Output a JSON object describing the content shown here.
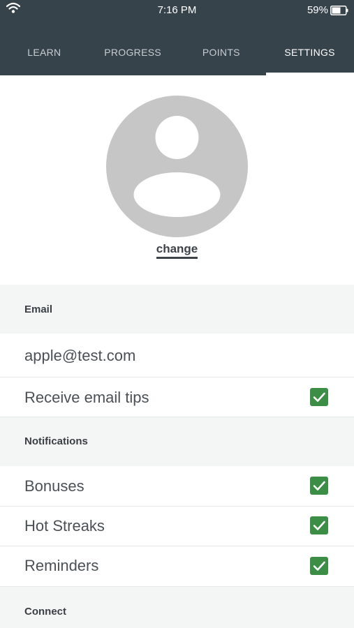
{
  "status_bar": {
    "time": "7:16 PM",
    "battery": "59%"
  },
  "tabs": [
    {
      "label": "LEARN"
    },
    {
      "label": "PROGRESS"
    },
    {
      "label": "POINTS"
    },
    {
      "label": "SETTINGS",
      "active": true
    }
  ],
  "profile": {
    "change_label": "change"
  },
  "sections": {
    "email": {
      "header": "Email",
      "address": "apple@test.com",
      "tips_label": "Receive email tips",
      "tips_checked": true
    },
    "notifications": {
      "header": "Notifications",
      "items": [
        {
          "label": "Bonuses",
          "checked": true
        },
        {
          "label": "Hot Streaks",
          "checked": true
        },
        {
          "label": "Reminders",
          "checked": true
        }
      ]
    },
    "connect": {
      "header": "Connect"
    }
  },
  "colors": {
    "top_bar": "#37434b",
    "checkbox": "#3c8d45",
    "section_background": "#f4f5f5",
    "avatar": "#c6c6c6"
  },
  "icons": [
    "wifi-icon",
    "battery-icon",
    "avatar-placeholder-icon",
    "checkmark-icon"
  ]
}
